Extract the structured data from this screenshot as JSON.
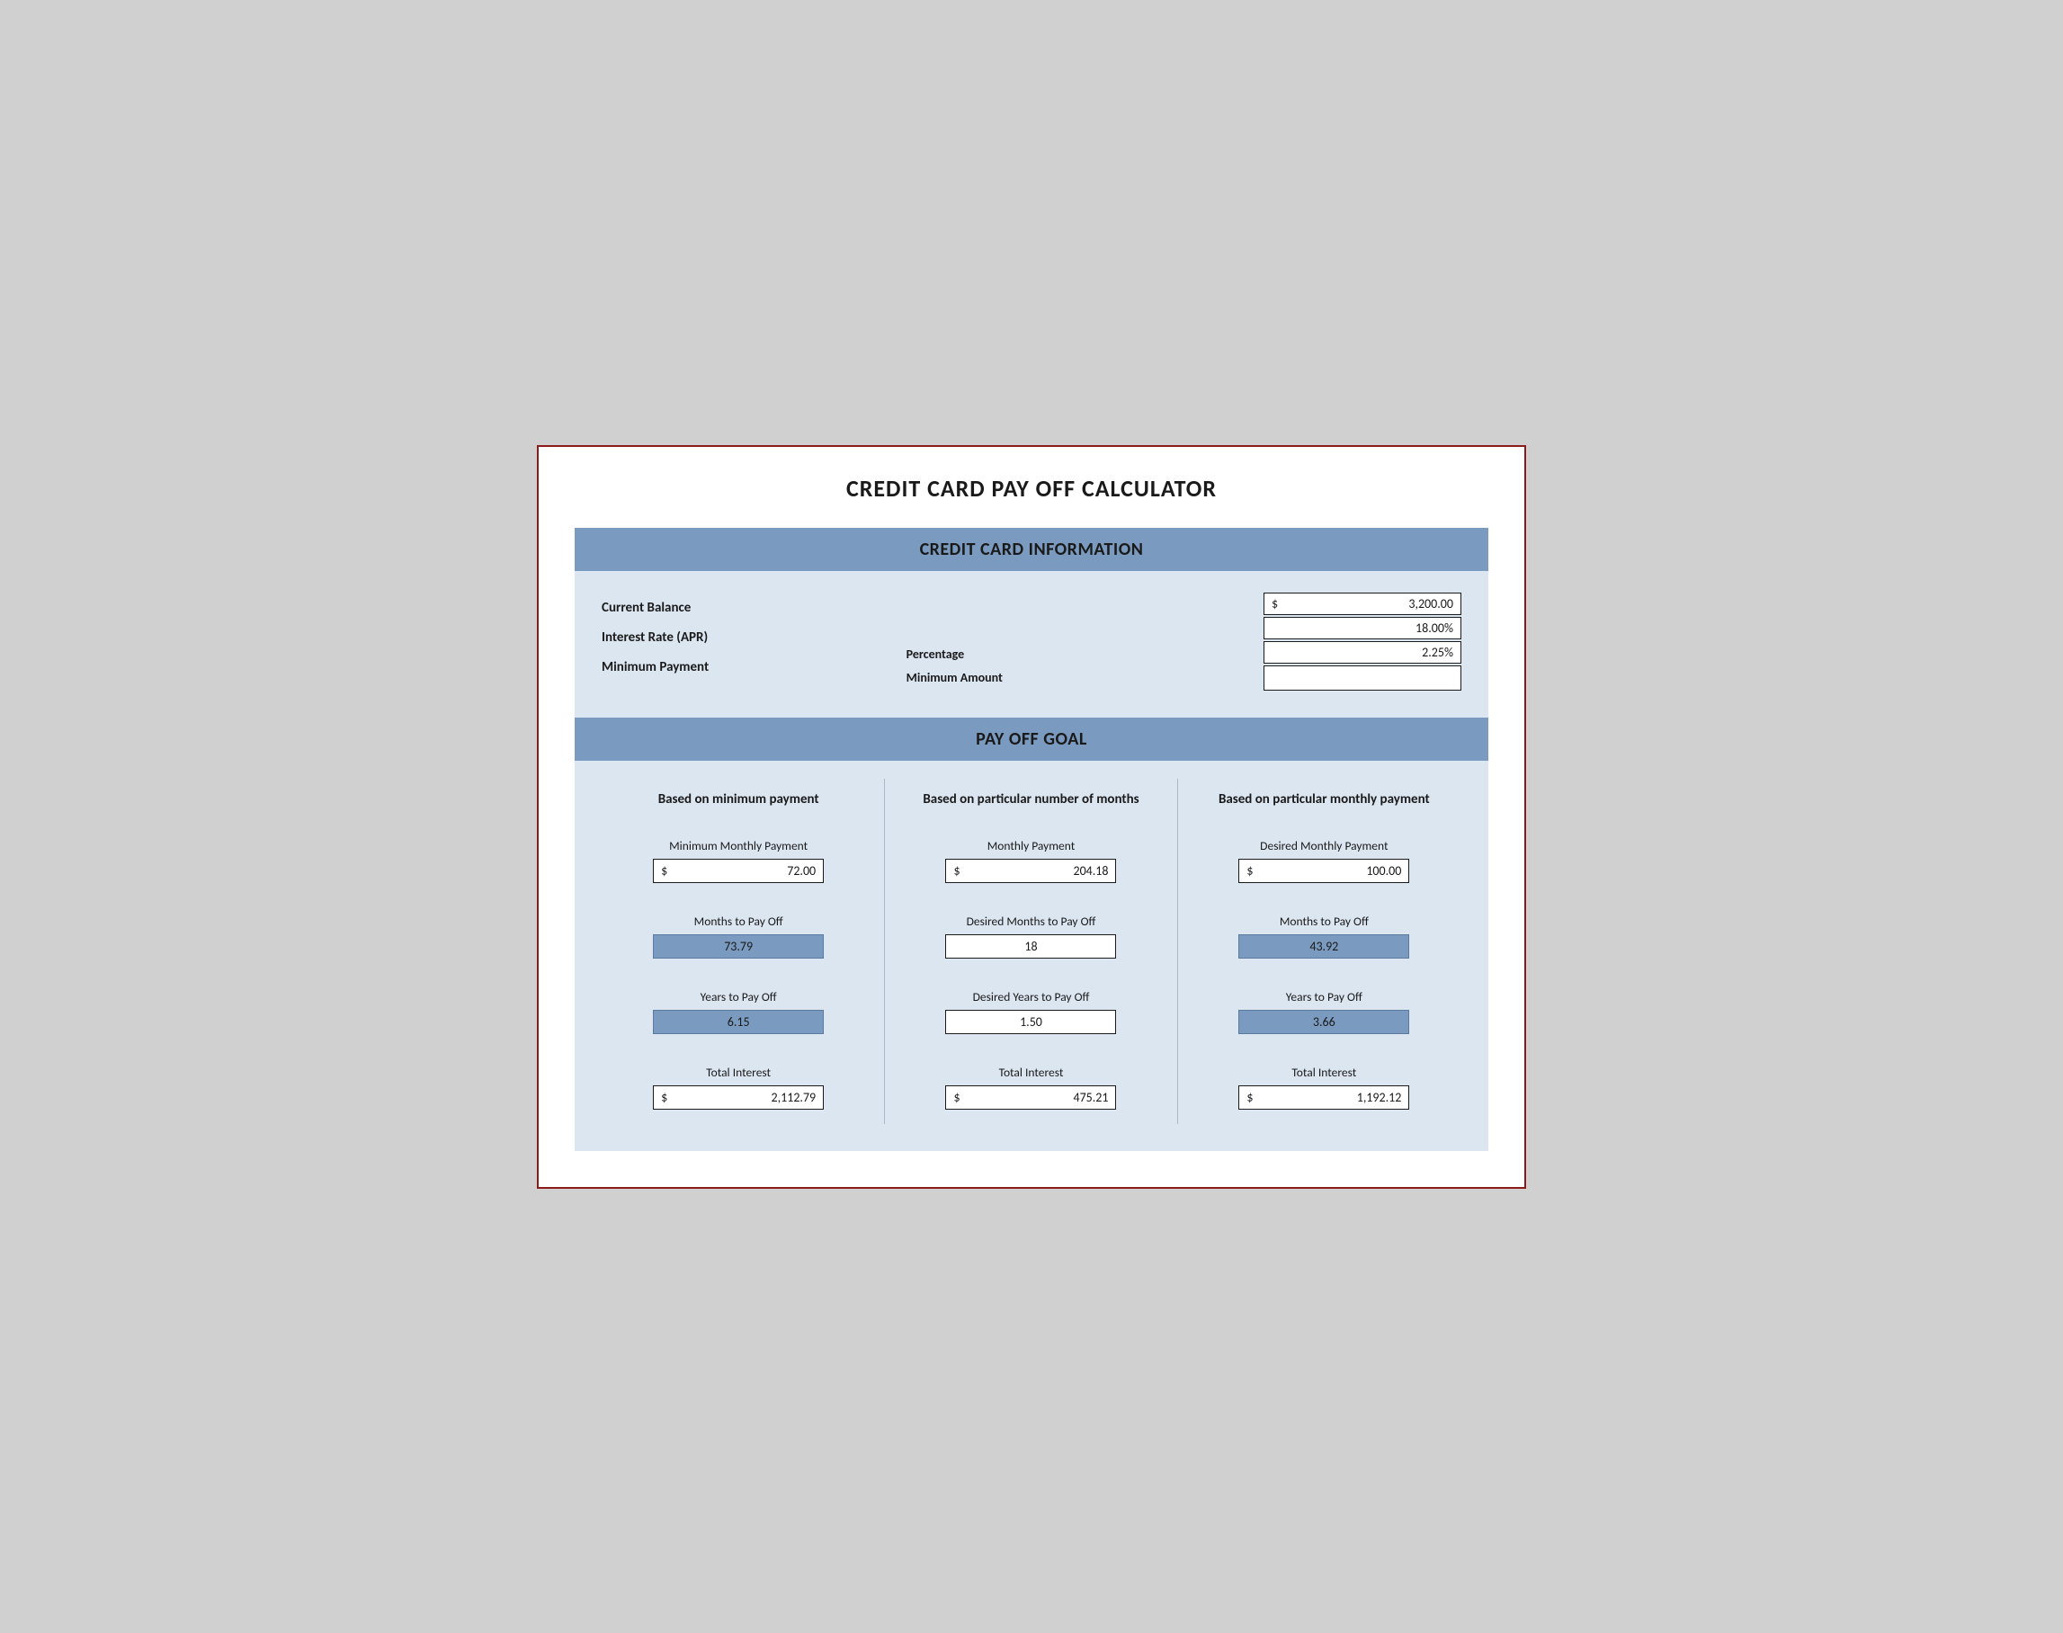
{
  "title": "CREDIT CARD PAY OFF CALCULATOR",
  "credit_info": {
    "section_header": "CREDIT CARD INFORMATION",
    "labels": {
      "current_balance": "Current Balance",
      "interest_rate": "Interest Rate (APR)",
      "minimum_payment": "Minimum Payment"
    },
    "middle_labels": {
      "percentage": "Percentage",
      "minimum_amount": "Minimum Amount"
    },
    "values": {
      "current_balance": "3,200.00",
      "interest_rate": "18.00%",
      "minimum_payment_pct": "2.25%",
      "minimum_amount": ""
    }
  },
  "payoff": {
    "section_header": "PAY OFF GOAL",
    "col1": {
      "title": "Based on minimum payment",
      "payment_label": "Minimum Monthly Payment",
      "payment_value": "72.00",
      "months_label": "Months to Pay Off",
      "months_value": "73.79",
      "years_label": "Years to Pay Off",
      "years_value": "6.15",
      "interest_label": "Total Interest",
      "interest_value": "2,112.79"
    },
    "col2": {
      "title": "Based on particular number of months",
      "payment_label": "Monthly Payment",
      "payment_value": "204.18",
      "months_label": "Desired Months to Pay Off",
      "months_value": "18",
      "years_label": "Desired Years to Pay Off",
      "years_value": "1.50",
      "interest_label": "Total Interest",
      "interest_value": "475.21"
    },
    "col3": {
      "title": "Based on particular monthly payment",
      "payment_label": "Desired Monthly Payment",
      "payment_value": "100.00",
      "months_label": "Months to Pay Off",
      "months_value": "43.92",
      "years_label": "Years to Pay Off",
      "years_value": "3.66",
      "interest_label": "Total Interest",
      "interest_value": "1,192.12"
    }
  },
  "currency_symbol": "$"
}
